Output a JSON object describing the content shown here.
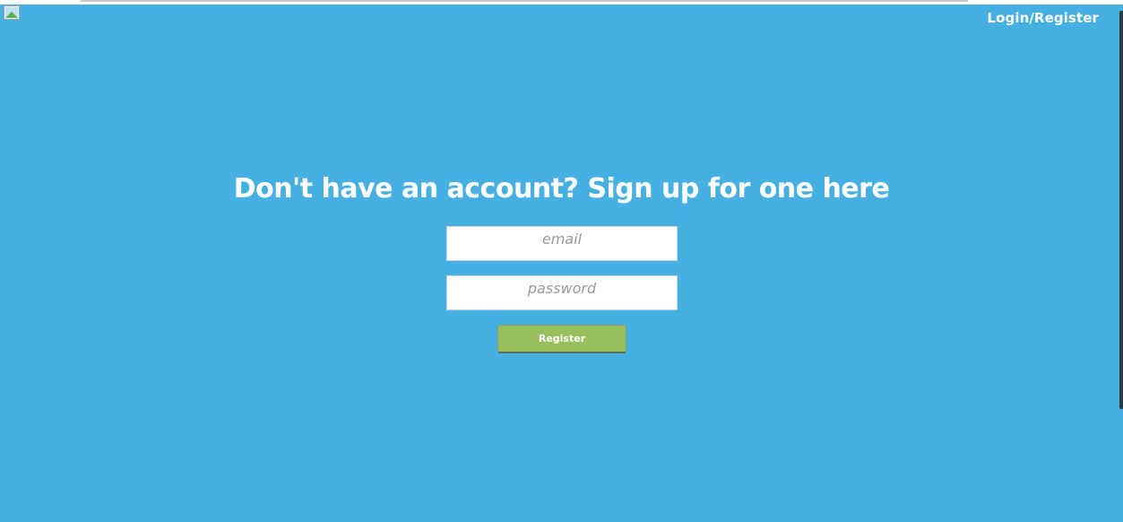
{
  "nav": {
    "login_register_label": "Login/Register"
  },
  "main": {
    "headline": "Don't have an account? Sign up for one here"
  },
  "form": {
    "email_placeholder": "email",
    "password_placeholder": "password",
    "register_label": "Register"
  },
  "colors": {
    "background": "#46b0e2",
    "button": "#97bf5c",
    "text": "#ffffff"
  },
  "icons": {
    "top_left": "broken-image-icon"
  }
}
